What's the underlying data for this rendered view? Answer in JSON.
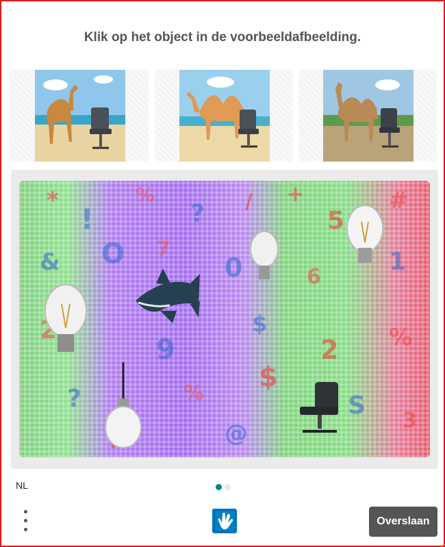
{
  "challenge": {
    "prompt": "Klik op het object in de voorbeeldafbeelding."
  },
  "examples": [
    {
      "subject": "camel-and-office-chair-beach"
    },
    {
      "subject": "camel-and-office-chair-beach"
    },
    {
      "subject": "camel-and-office-chair-field"
    }
  ],
  "task_image": {
    "objects": [
      "light-bulb",
      "shark",
      "light-bulb",
      "light-bulb",
      "light-bulb",
      "office-chair"
    ]
  },
  "footer": {
    "language": "NL",
    "pagination": {
      "total": 2,
      "active": 1,
      "active_color": "#00838f",
      "inactive_color": "#e8e8e8"
    },
    "menu_icon": "more-vertical-icon",
    "logo_icon": "hcaptcha-logo-icon",
    "skip_label": "Overslaan"
  },
  "colors": {
    "border": "#e01a1a",
    "title": "#555555",
    "button_bg": "#555555"
  }
}
